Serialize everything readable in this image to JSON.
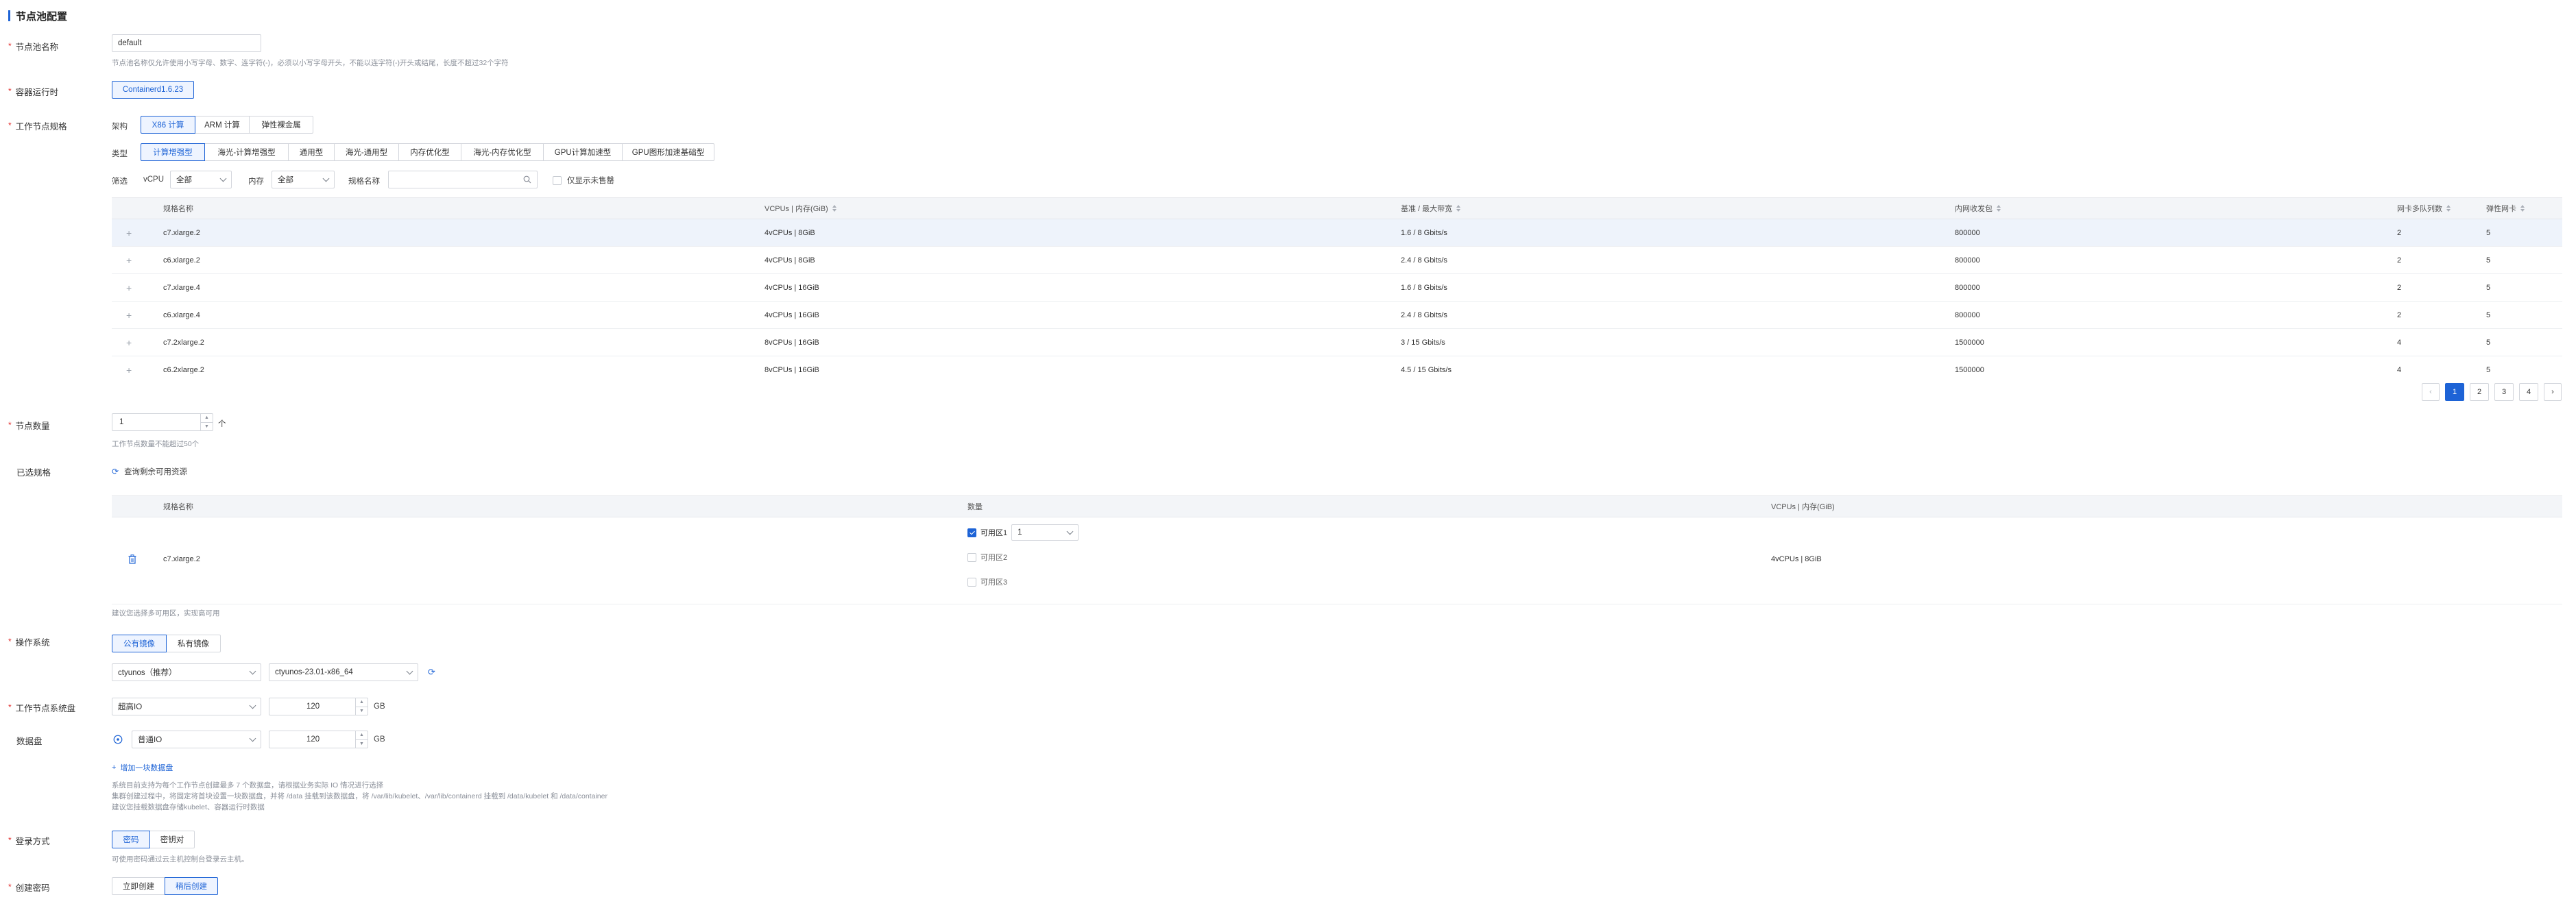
{
  "section": {
    "title": "节点池配置"
  },
  "pool_name": {
    "label": "节点池名称",
    "value": "default",
    "hint": "节点池名称仅允许使用小写字母、数字、连字符(-)，必须以小写字母开头，不能以连字符(-)开头或结尾，长度不超过32个字符"
  },
  "runtime": {
    "label": "容器运行时",
    "value": "Containerd1.6.23"
  },
  "spec": {
    "label": "工作节点规格",
    "arch_label": "架构",
    "arch_options": [
      "X86 计算",
      "ARM 计算",
      "弹性裸金属"
    ],
    "type_label": "类型",
    "type_options": [
      "计算增强型",
      "海光-计算增强型",
      "通用型",
      "海光-通用型",
      "内存优化型",
      "海光-内存优化型",
      "GPU计算加速型",
      "GPU图形加速基础型"
    ],
    "filter_label": "筛选",
    "vcpu_label": "vCPU",
    "vcpu_value": "全部",
    "mem_label": "内存",
    "mem_value": "全部",
    "spec_name_label": "规格名称",
    "spec_name_placeholder": "",
    "only_available_label": "仅显示未售罄",
    "columns": [
      "规格名称",
      "VCPUs | 内存(GiB)",
      "基准 / 最大带宽",
      "内网收发包",
      "网卡多队列数",
      "弹性网卡"
    ],
    "rows": [
      {
        "name": "c7.xlarge.2",
        "cpu_mem": "4vCPUs | 8GiB",
        "bandwidth": "1.6 / 8 Gbits/s",
        "pps": "800000",
        "queues": "2",
        "eni": "5"
      },
      {
        "name": "c6.xlarge.2",
        "cpu_mem": "4vCPUs | 8GiB",
        "bandwidth": "2.4 / 8 Gbits/s",
        "pps": "800000",
        "queues": "2",
        "eni": "5"
      },
      {
        "name": "c7.xlarge.4",
        "cpu_mem": "4vCPUs | 16GiB",
        "bandwidth": "1.6 / 8 Gbits/s",
        "pps": "800000",
        "queues": "2",
        "eni": "5"
      },
      {
        "name": "c6.xlarge.4",
        "cpu_mem": "4vCPUs | 16GiB",
        "bandwidth": "2.4 / 8 Gbits/s",
        "pps": "800000",
        "queues": "2",
        "eni": "5"
      },
      {
        "name": "c7.2xlarge.2",
        "cpu_mem": "8vCPUs | 16GiB",
        "bandwidth": "3 / 15 Gbits/s",
        "pps": "1500000",
        "queues": "4",
        "eni": "5"
      },
      {
        "name": "c6.2xlarge.2",
        "cpu_mem": "8vCPUs | 16GiB",
        "bandwidth": "4.5 / 15 Gbits/s",
        "pps": "1500000",
        "queues": "4",
        "eni": "5"
      }
    ],
    "pages": [
      "1",
      "2",
      "3",
      "4"
    ],
    "current_page": "1"
  },
  "node_count": {
    "label": "节点数量",
    "value": "1",
    "unit": "个",
    "hint": "工作节点数量不能超过50个"
  },
  "selected": {
    "label": "已选规格",
    "query_link": "查询剩余可用资源",
    "columns": [
      "规格名称",
      "数量",
      "VCPUs | 内存(GiB)"
    ],
    "row": {
      "name": "c7.xlarge.2",
      "cpu_mem": "4vCPUs | 8GiB",
      "zones": [
        {
          "label": "可用区1",
          "checked": true,
          "count": "1"
        },
        {
          "label": "可用区2",
          "checked": false
        },
        {
          "label": "可用区3",
          "checked": false
        }
      ]
    },
    "hint": "建议您选择多可用区，实现高可用"
  },
  "os": {
    "label": "操作系统",
    "tabs": [
      "公有镜像",
      "私有镜像"
    ],
    "os_value": "ctyunos（推荐）",
    "version_value": "ctyunos-23.01-x86_64"
  },
  "system_disk": {
    "label": "工作节点系统盘",
    "type": "超高IO",
    "size": "120",
    "unit": "GB"
  },
  "data_disk": {
    "label": "数据盘",
    "type": "普通IO",
    "size": "120",
    "unit": "GB",
    "add_link": "增加一块数据盘",
    "hints": [
      "系统目前支持为每个工作节点创建最多 7 个数据盘，请根据业务实际 IO 情况进行选择",
      "集群创建过程中，将固定将首块设置一块数据盘，并将 /data 挂载到该数据盘，将 /var/lib/kubelet、/var/lib/containerd 挂载到 /data/kubelet 和 /data/container",
      "建议您挂载数据盘存储kubelet、容器运行时数据"
    ]
  },
  "login": {
    "label": "登录方式",
    "options": [
      "密码",
      "密钥对"
    ],
    "hint": "可使用密码通过云主机控制台登录云主机。"
  },
  "password": {
    "label": "创建密码",
    "options": [
      "立即创建",
      "稍后创建"
    ]
  },
  "colors": {
    "accent": "#1d63d6",
    "required": "#e3302f"
  }
}
